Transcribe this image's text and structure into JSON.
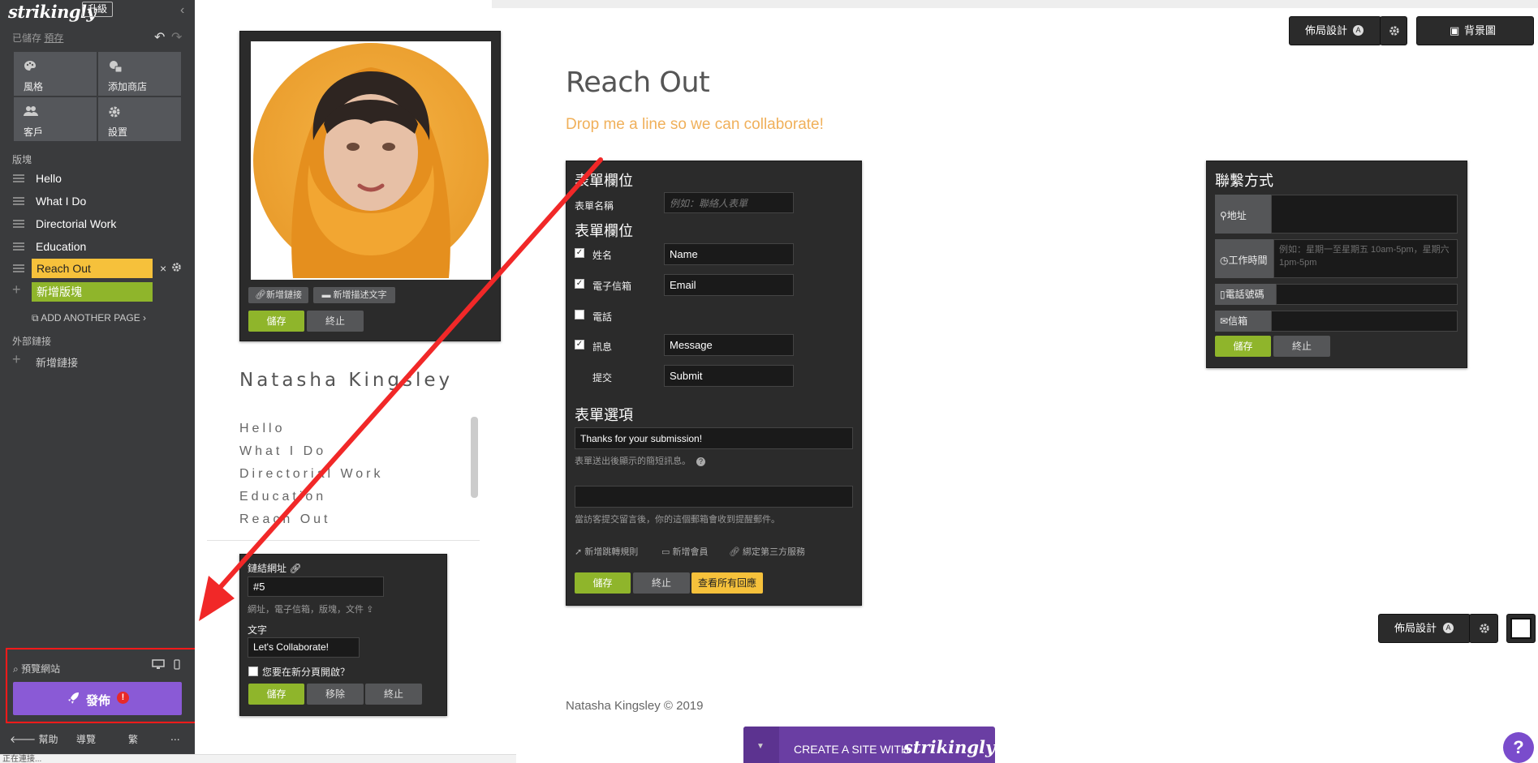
{
  "sidebar": {
    "logo": "strikingly",
    "upgrade": "升級",
    "status_saved": "已儲存",
    "status_preview": "預存",
    "tiles": [
      {
        "label": "風格",
        "icon": "palette-icon"
      },
      {
        "label": "添加商店",
        "icon": "store-icon"
      },
      {
        "label": "客戶",
        "icon": "users-icon"
      },
      {
        "label": "設置",
        "icon": "gear-icon"
      }
    ],
    "sections_heading": "版塊",
    "pages": [
      "Hello",
      "What I Do",
      "Directorial Work",
      "Education"
    ],
    "active_page": "Reach Out",
    "new_section": "新增版塊",
    "add_page": "ADD ANOTHER PAGE",
    "external_heading": "外部鏈接",
    "new_link": "新增鏈接",
    "preview": "預覽網站",
    "publish": "發佈",
    "bottom": {
      "help": "幫助",
      "guide": "導覽",
      "lang": "繁",
      "more": "..."
    }
  },
  "status_bar": "正在連接...",
  "left_column": {
    "image_toolbar": {
      "add_link": "新增鏈接",
      "add_caption": "新增描述文字",
      "save": "儲存",
      "cancel": "終止"
    },
    "name": "Natasha Kingsley",
    "nav": [
      "Hello",
      "What I Do",
      "Directorial Work",
      "Education",
      "Reach Out"
    ],
    "link_editor": {
      "link_label": "鏈結網址",
      "link_value": "#5",
      "link_hint": "網址，電子信箱，版塊，文件",
      "text_label": "文字",
      "text_value": "Let's Collaborate!",
      "new_tab": "您要在新分頁開啟？",
      "save": "儲存",
      "remove": "移除",
      "cancel": "終止"
    }
  },
  "top_buttons": {
    "layout": "佈局設計",
    "layout_badge": "A",
    "background": "背景圖"
  },
  "section": {
    "title": "Reach Out",
    "subtitle": "Drop me a line so we can collaborate!",
    "accent": "#f0b05a"
  },
  "form_panel": {
    "title1": "表單欄位",
    "form_name_label": "表單名稱",
    "form_name_placeholder": "例如：聯絡人表單",
    "title2": "表單欄位",
    "fields": [
      {
        "label": "姓名",
        "value": "Name",
        "checked": true
      },
      {
        "label": "電子信箱",
        "value": "Email",
        "checked": true
      },
      {
        "label": "電話",
        "value": "",
        "checked": false
      },
      {
        "label": "訊息",
        "value": "Message",
        "checked": true
      }
    ],
    "submit_label": "提交",
    "submit_value": "Submit",
    "options_title": "表單選項",
    "thanks_value": "Thanks for your submission!",
    "thanks_hint": "表單送出後顯示的簡短訊息。",
    "email_hint": "當訪客提交留言後，你的這個郵箱會收到提醒郵件。",
    "links": [
      "新增跳轉規則",
      "新增會員",
      "綁定第三方服務"
    ],
    "save": "儲存",
    "cancel": "終止",
    "view_all": "查看所有回應"
  },
  "contact_panel": {
    "title": "聯繫方式",
    "address_label": "地址",
    "hours_label": "工作時間",
    "hours_placeholder": "例如：星期一至星期五 10am-5pm，星期六 1pm-5pm",
    "phone_label": "電話號碼",
    "email_label": "信箱",
    "save": "儲存",
    "cancel": "終止"
  },
  "footer": {
    "copyright": "Natasha Kingsley © 2019",
    "cta_prefix": "CREATE A SITE WITH",
    "cta_brand": "strikingly",
    "layout": "佈局設計",
    "layout_badge": "A",
    "help": "?"
  }
}
